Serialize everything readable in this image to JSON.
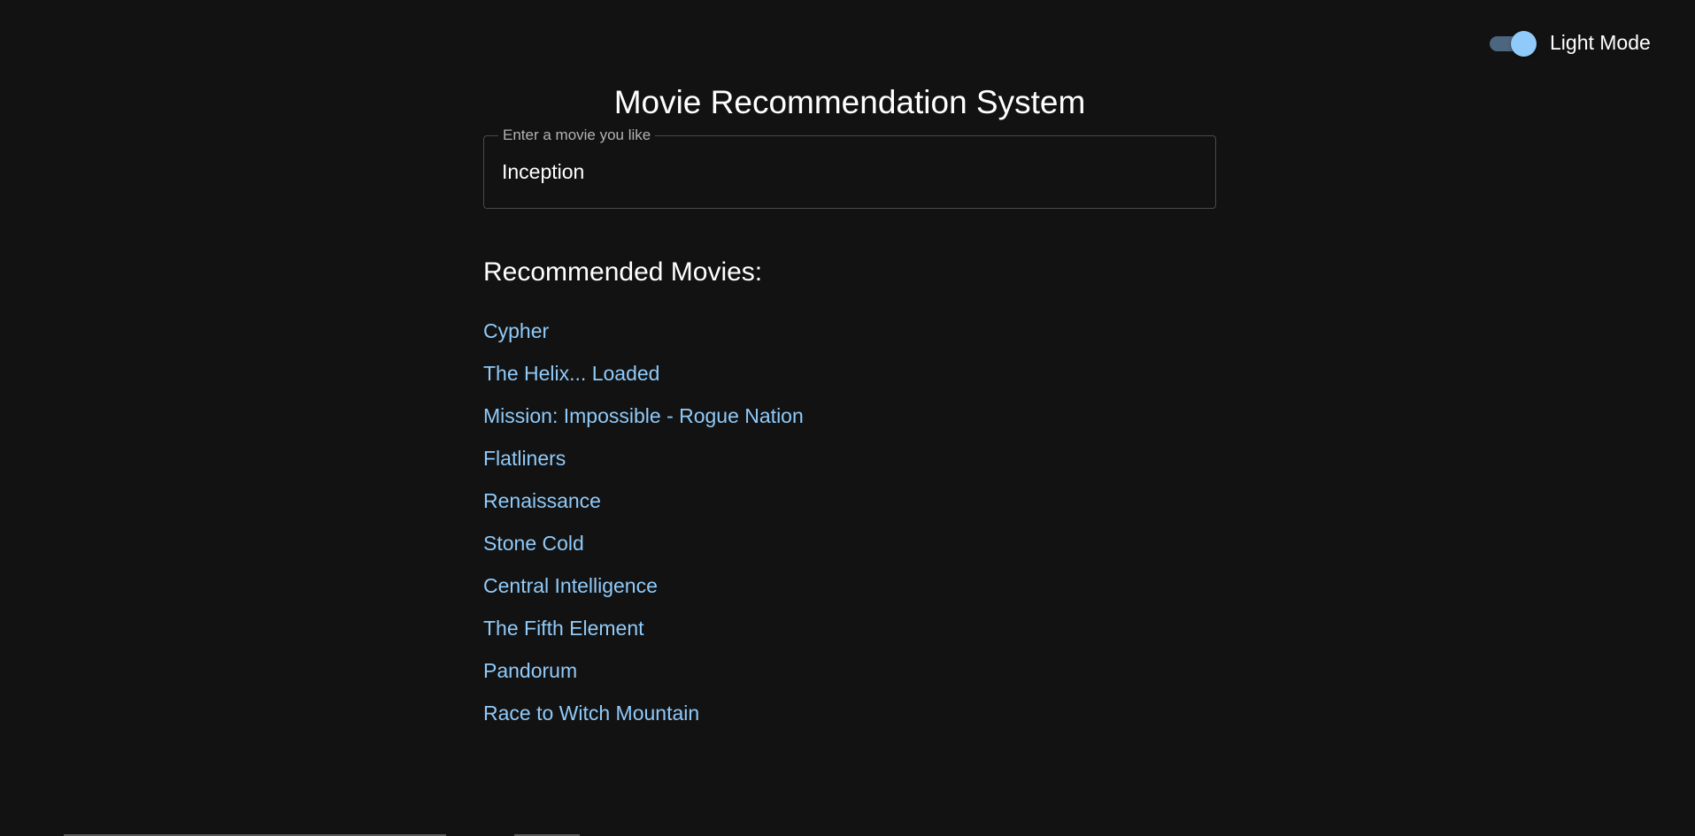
{
  "theme_toggle": {
    "label": "Light Mode",
    "checked": true
  },
  "title": "Movie Recommendation System",
  "search": {
    "label": "Enter a movie you like",
    "value": "Inception"
  },
  "results": {
    "heading": "Recommended Movies:",
    "items": [
      "Cypher",
      "The Helix... Loaded",
      "Mission: Impossible - Rogue Nation",
      "Flatliners",
      "Renaissance",
      "Stone Cold",
      "Central Intelligence",
      "The Fifth Element",
      "Pandorum",
      "Race to Witch Mountain"
    ]
  },
  "colors": {
    "background": "#121212",
    "link": "#90caf9",
    "toggle_thumb": "#90caf9",
    "toggle_track": "#4d6680",
    "text": "#ffffff"
  }
}
